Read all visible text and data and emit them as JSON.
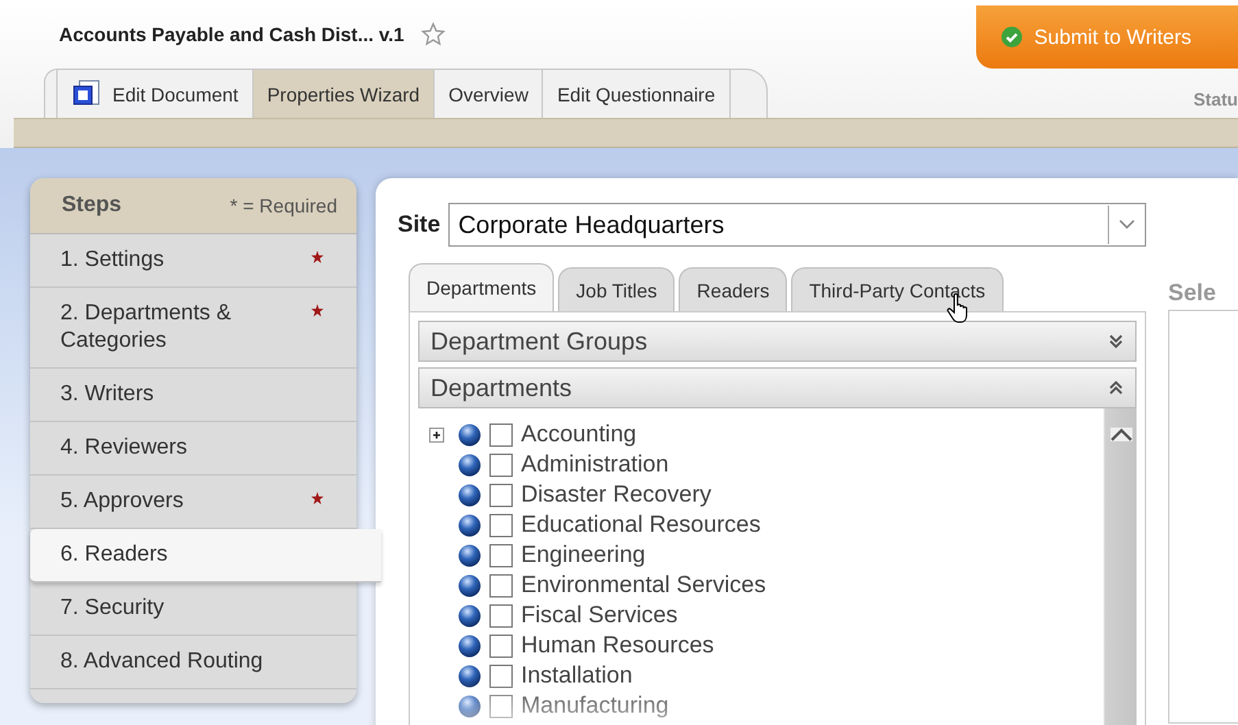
{
  "document": {
    "title": "Accounts Payable and Cash Dist... v.1",
    "starred": false
  },
  "submit_button": {
    "label": "Submit to Writers"
  },
  "main_tabs": [
    {
      "label": "Edit Document",
      "selected": false,
      "icon": true
    },
    {
      "label": "Properties Wizard",
      "selected": true,
      "icon": false
    },
    {
      "label": "Overview",
      "selected": false,
      "icon": false
    },
    {
      "label": "Edit Questionnaire",
      "selected": false,
      "icon": false
    }
  ],
  "status_label": "Statu",
  "steps": {
    "title": "Steps",
    "legend": "* = Required",
    "items": [
      {
        "label": "1. Settings",
        "required": true,
        "selected": false
      },
      {
        "label": "2. Departments & Categories",
        "required": true,
        "selected": false
      },
      {
        "label": "3. Writers",
        "required": false,
        "selected": false
      },
      {
        "label": "4. Reviewers",
        "required": false,
        "selected": false
      },
      {
        "label": "5. Approvers",
        "required": true,
        "selected": false
      },
      {
        "label": "6. Readers",
        "required": false,
        "selected": true
      },
      {
        "label": "7. Security",
        "required": false,
        "selected": false
      },
      {
        "label": "8. Advanced Routing",
        "required": false,
        "selected": false
      }
    ]
  },
  "site": {
    "label": "Site",
    "value": "Corporate Headquarters"
  },
  "reader_tabs": [
    {
      "label": "Departments",
      "selected": true
    },
    {
      "label": "Job Titles",
      "selected": false
    },
    {
      "label": "Readers",
      "selected": false
    },
    {
      "label": "Third-Party Contacts",
      "selected": false
    }
  ],
  "sections": [
    {
      "title": "Department Groups",
      "expanded": false
    },
    {
      "title": "Departments",
      "expanded": true
    }
  ],
  "departments": [
    {
      "name": "Accounting",
      "expandable": true,
      "checked": false
    },
    {
      "name": "Administration",
      "expandable": false,
      "checked": false
    },
    {
      "name": "Disaster Recovery",
      "expandable": false,
      "checked": false
    },
    {
      "name": "Educational Resources",
      "expandable": false,
      "checked": false
    },
    {
      "name": "Engineering",
      "expandable": false,
      "checked": false
    },
    {
      "name": "Environmental Services",
      "expandable": false,
      "checked": false
    },
    {
      "name": "Fiscal Services",
      "expandable": false,
      "checked": false
    },
    {
      "name": "Human Resources",
      "expandable": false,
      "checked": false
    },
    {
      "name": "Installation",
      "expandable": false,
      "checked": false
    },
    {
      "name": "Manufacturing",
      "expandable": false,
      "checked": false
    }
  ],
  "selected_panel_label": "Sele"
}
